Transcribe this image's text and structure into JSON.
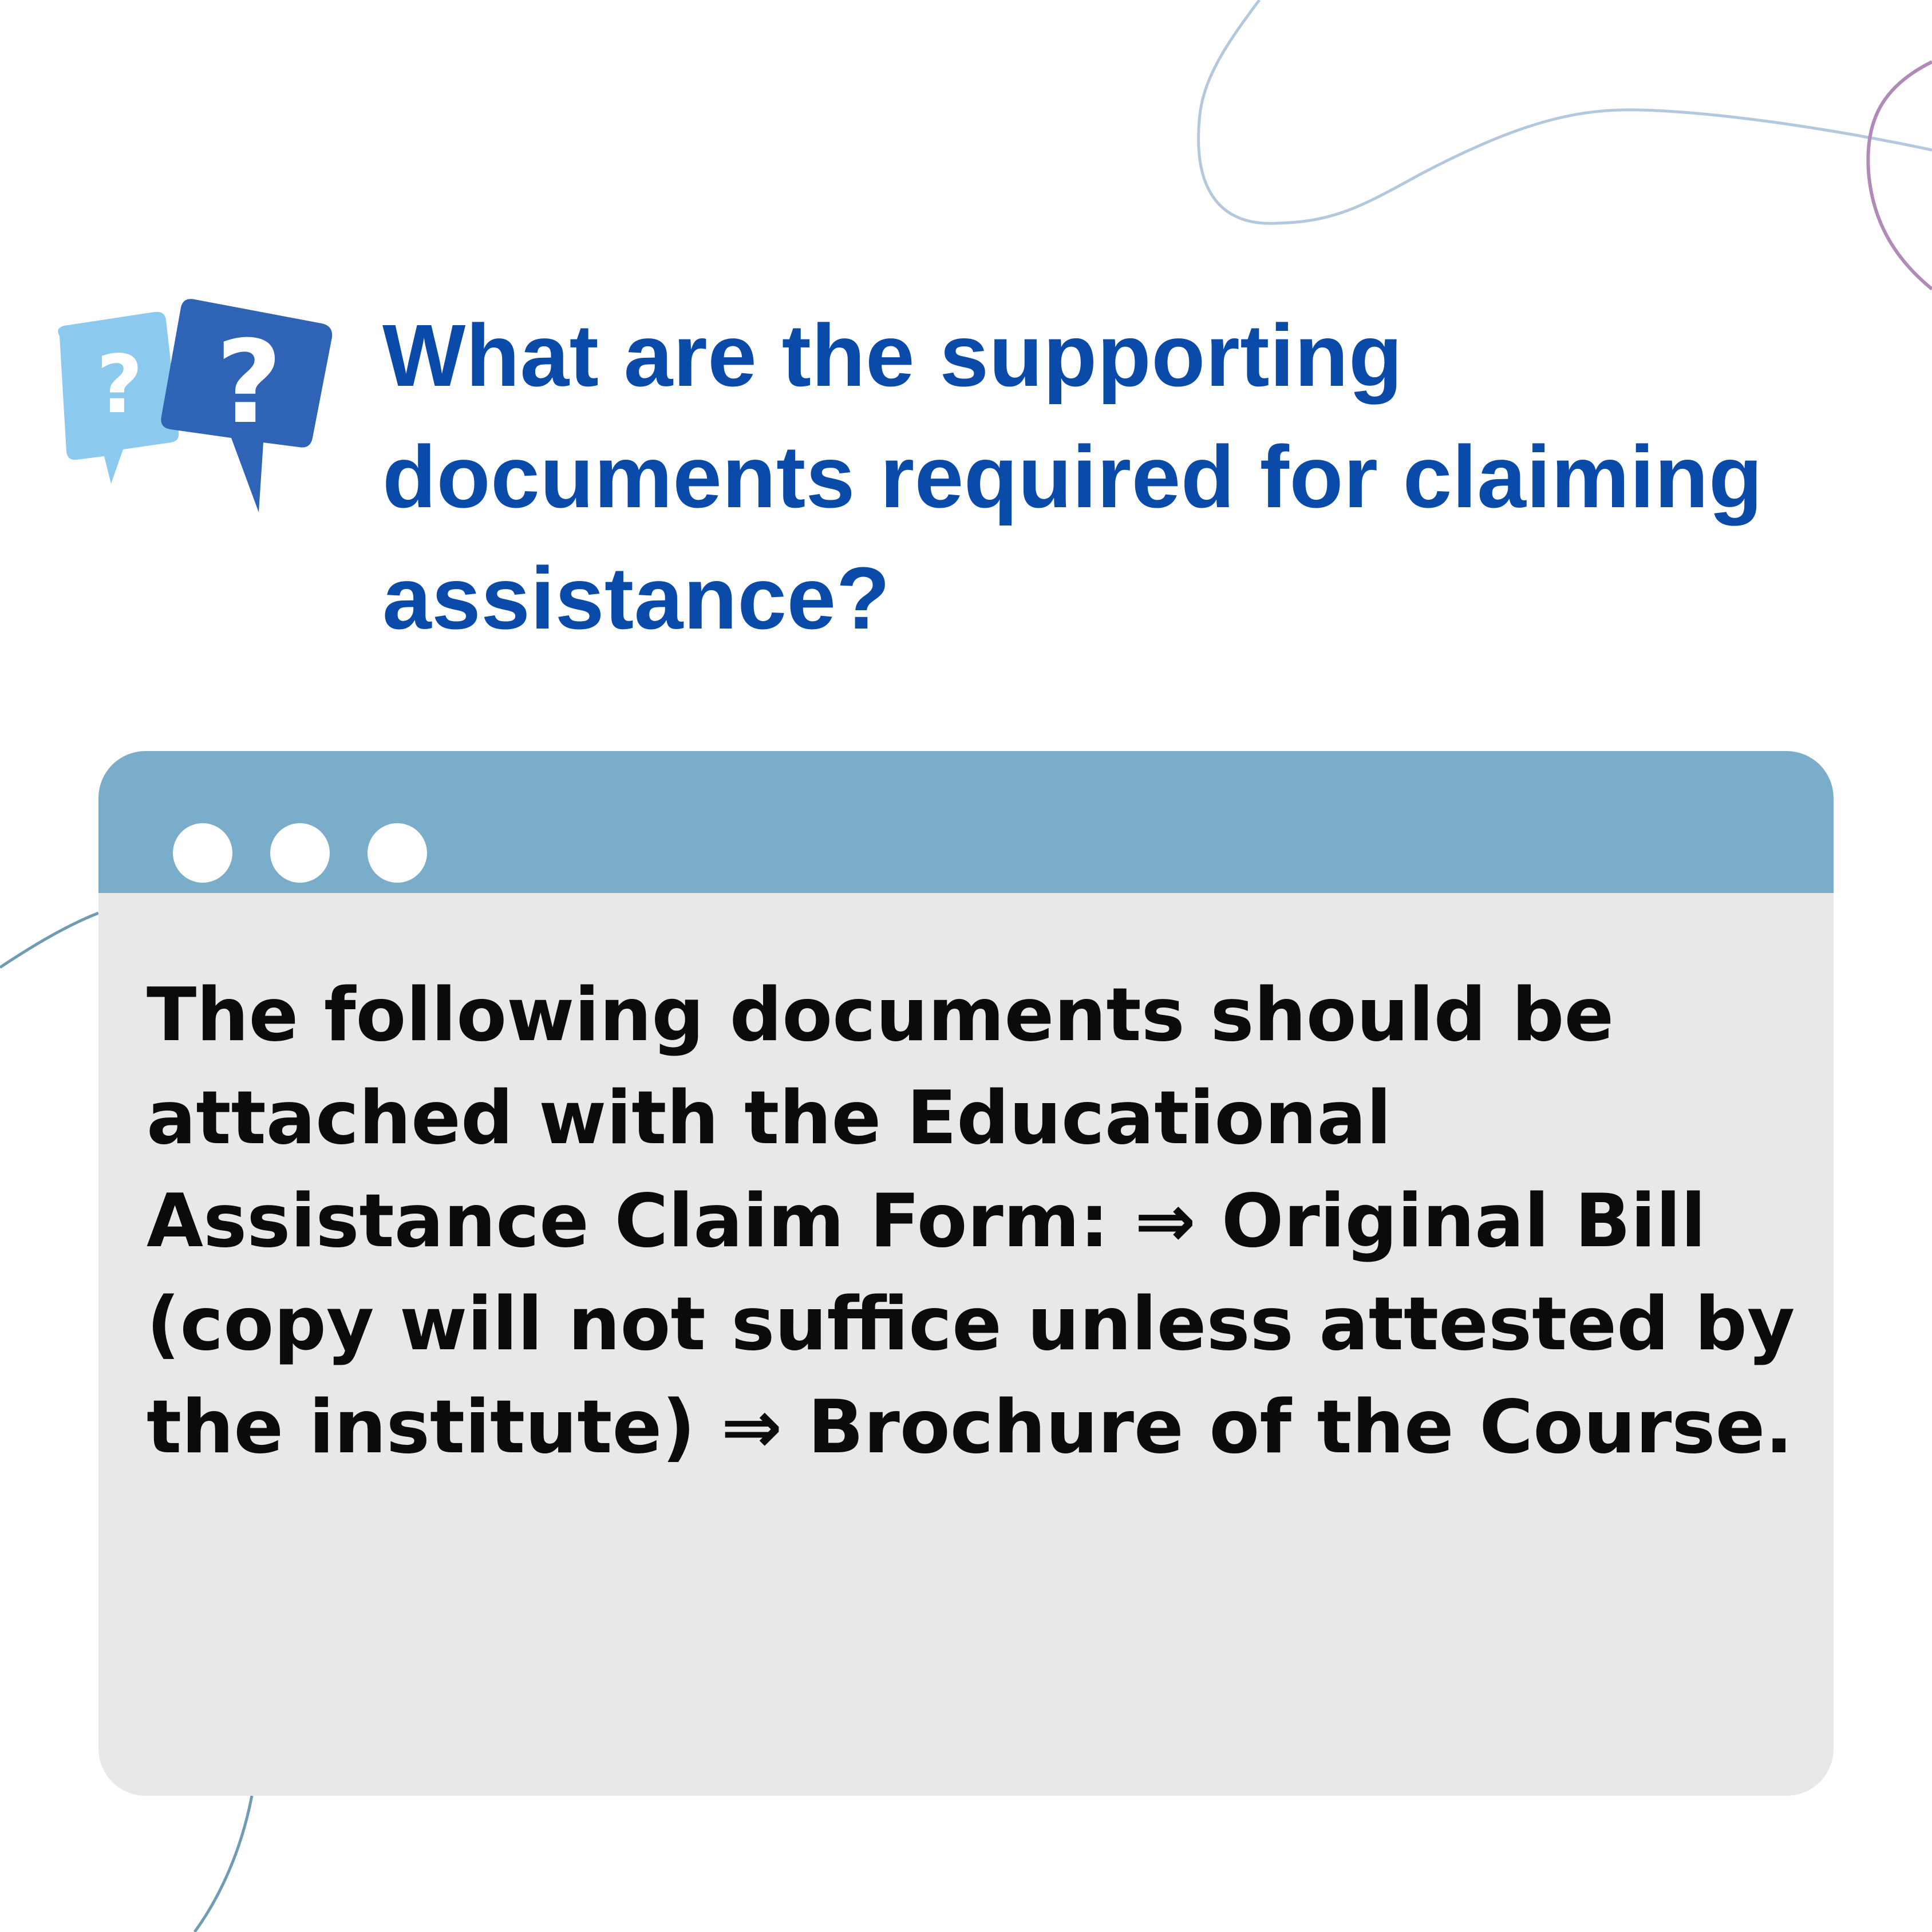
{
  "question": {
    "text": "What are the supporting documents required for claiming assistance?",
    "color": "#0a4aa8"
  },
  "icon": {
    "name": "question-bubbles-icon",
    "glyph_small": "?",
    "glyph_large": "?"
  },
  "window": {
    "bar_color": "#79adc9",
    "body_color": "#e8e8e8",
    "dots": [
      "window-dot",
      "window-dot",
      "window-dot"
    ]
  },
  "answer": {
    "text": "The following documents should be attached with the Educational Assistance Claim Form: ⇒ Original Bill (copy will not suffice unless attested by the institute) ⇒ Brochure of the Course."
  }
}
